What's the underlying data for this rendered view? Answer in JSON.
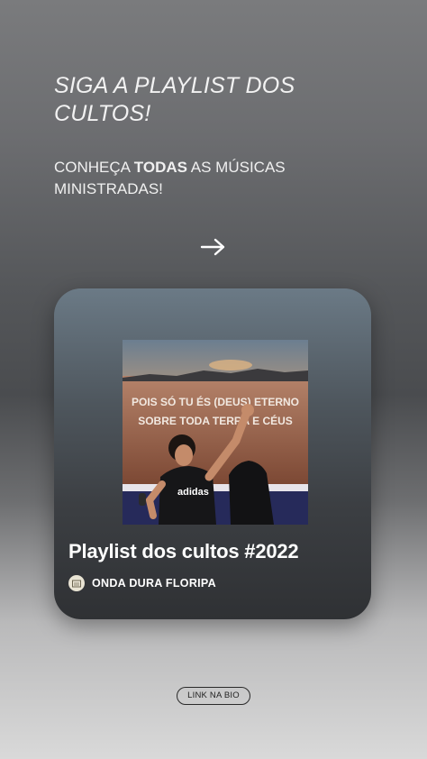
{
  "header": {
    "headline": "SIGA A PLAYLIST DOS CULTOS!",
    "sub_prefix": "CONHEÇA ",
    "sub_bold": "TODAS",
    "sub_suffix": " AS MÚSICAS MINISTRADAS!"
  },
  "icons": {
    "arrow": "arrow-right-icon",
    "avatar": "church-logo-icon"
  },
  "card": {
    "cover_lyrics_line1": "POIS SÓ TU ÉS (DEUS) ETERNO",
    "cover_lyrics_line2": "SOBRE TODA TERRA E CÉUS",
    "cover_shirt": "adidas",
    "title": "Playlist dos cultos #2022",
    "owner": "ONDA DURA FLORIPA"
  },
  "footer": {
    "link_label": "LINK NA BIO"
  },
  "colors": {
    "text": "#ffffff",
    "card_top": "#6b7a86",
    "card_bottom": "#2f3134"
  }
}
